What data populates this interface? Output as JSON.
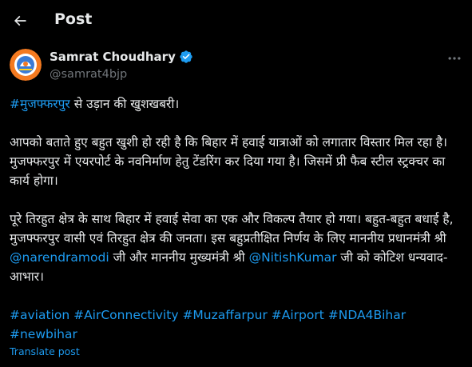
{
  "header": {
    "title": "Post",
    "back_icon": "arrow-left-icon"
  },
  "author": {
    "name": "Samrat Choudhary",
    "handle": "@samrat4bjp",
    "verified_icon": "verified-badge-icon",
    "avatar_icon": "party-logo-avatar"
  },
  "more_icon": "more-horizontal-icon",
  "post": {
    "p1": {
      "tag": "#मुजफ्फरपुर",
      "text": " से उड़ान की खुशखबरी।"
    },
    "p2": "आपको बताते हुए बहुत खुशी हो रही है कि बिहार में हवाई यात्राओं को लगातार विस्तार मिल रहा है। मुजफ्फरपुर में एयरपोर्ट के नवनिर्माण हेतु टेंडरिंग कर दिया गया है। जिसमें प्री फैब स्टील स्ट्रक्चर का कार्य होगा।",
    "p3": {
      "t1": "पूरे तिरहुत क्षेत्र के साथ बिहार में हवाई सेवा का एक और विकल्प तैयार हो गया। बहुत-बहुत बधाई है, मुजफ्फरपुर वासी एवं तिरहुत क्षेत्र की जनता। इस बहुप्रतीक्षित निर्णय के लिए माननीय प्रधानमंत्री श्री ",
      "mention1": "@narendramodi",
      "t2": " जी और माननीय मुख्यमंत्री श्री ",
      "mention2": "@NitishKumar",
      "t3": " जी को कोटिश धन्यवाद-आभार।"
    },
    "hashtags": [
      "#aviation",
      "#AirConnectivity",
      "#Muzaffarpur",
      "#Airport",
      "#NDA4Bihar",
      "#newbihar"
    ]
  },
  "translate_label": "Translate post",
  "colors": {
    "background": "#000000",
    "text": "#e7e9ea",
    "secondary": "#71767b",
    "link": "#1d9bf0"
  }
}
